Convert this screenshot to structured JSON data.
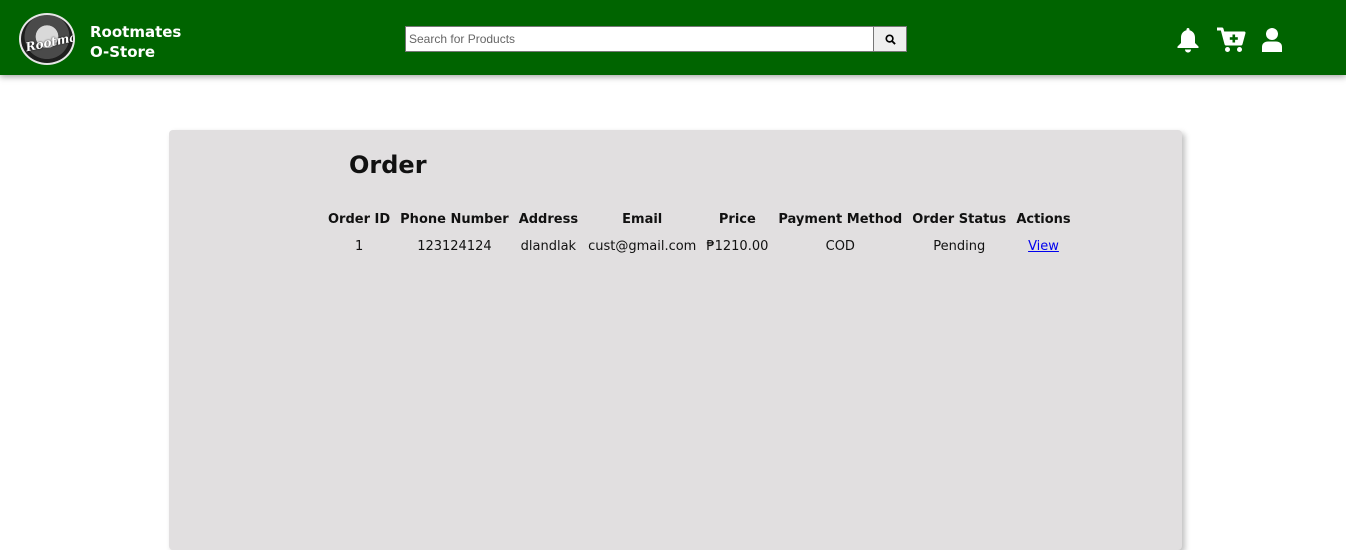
{
  "header": {
    "brand_line1": "Rootmates",
    "brand_line2": "O-Store",
    "logo_text": "Rootmates",
    "search": {
      "placeholder": "Search for Products",
      "value": ""
    },
    "icons": [
      "search-icon",
      "bell-icon",
      "cart-add-icon",
      "user-icon"
    ],
    "background": "#006400"
  },
  "main": {
    "title": "Order",
    "table": {
      "columns": [
        "Order ID",
        "Phone Number",
        "Address",
        "Email",
        "Price",
        "Payment Method",
        "Order Status",
        "Actions"
      ],
      "rows": [
        {
          "order_id": "1",
          "phone": "123124124",
          "address": "dlandlak",
          "email": "cust@gmail.com",
          "price": "₱1210.00",
          "payment_method": "COD",
          "status": "Pending",
          "action": "View"
        }
      ]
    },
    "card_background": "#e1dfe0"
  }
}
